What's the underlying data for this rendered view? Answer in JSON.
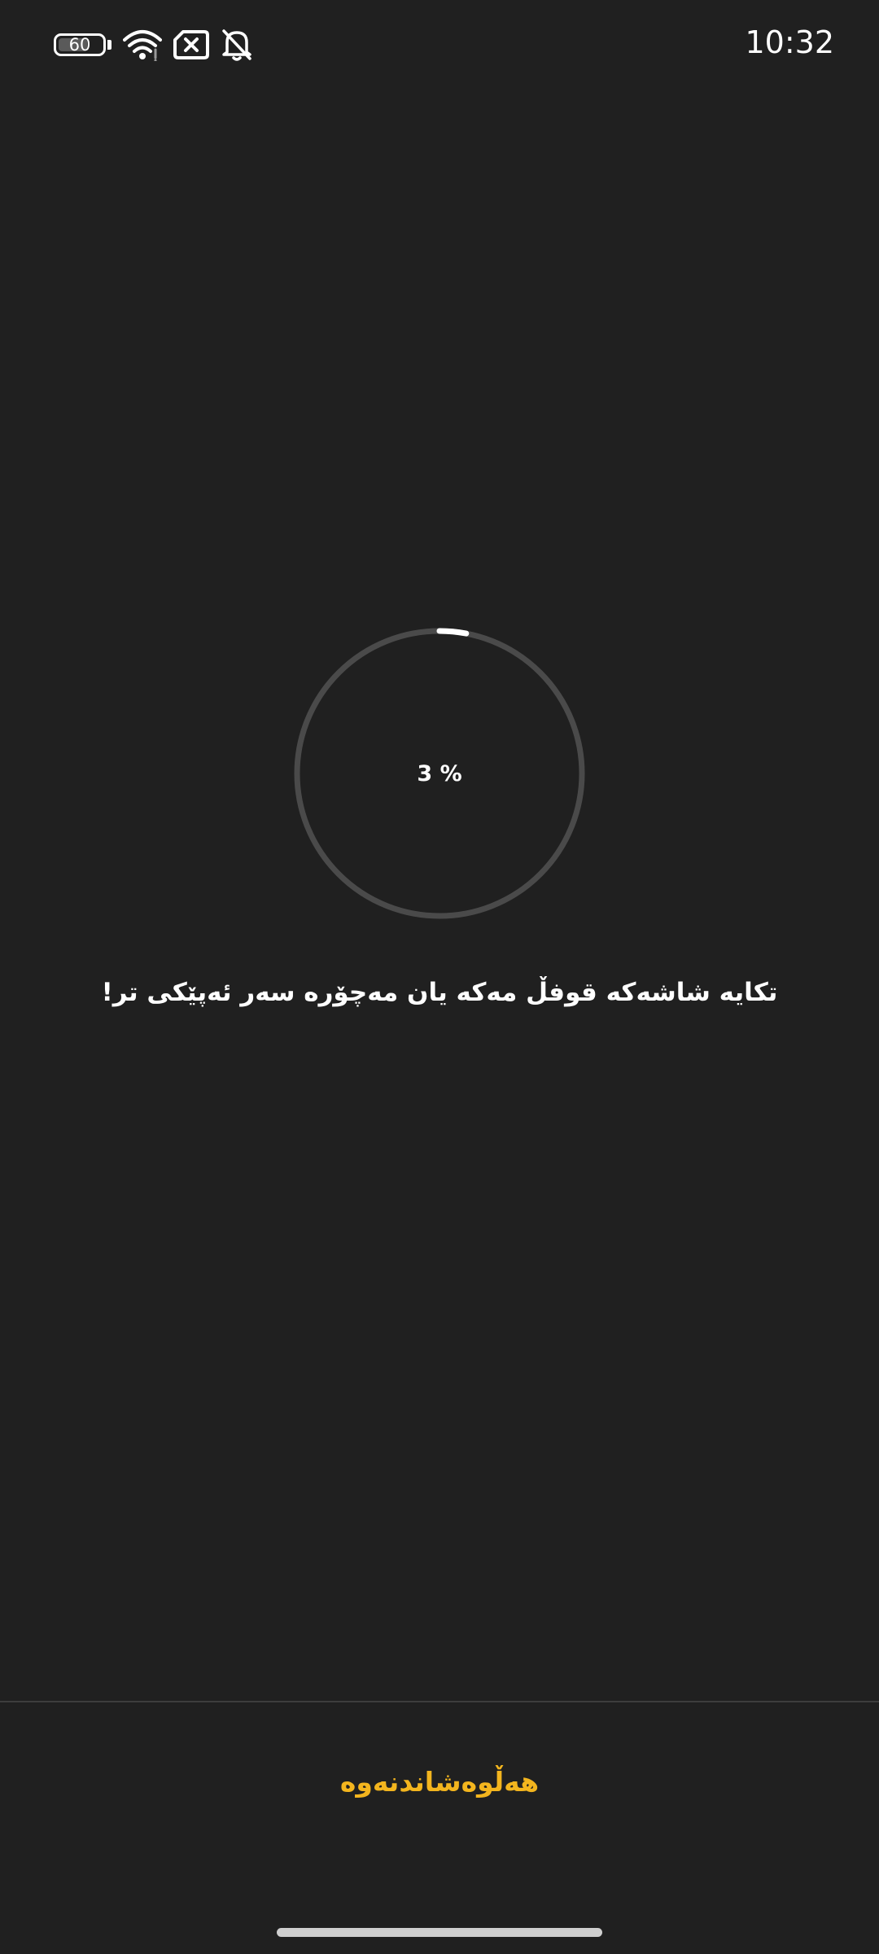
{
  "status_bar": {
    "battery_level": "60",
    "time": "10:32",
    "icons": [
      "battery-icon",
      "wifi-icon",
      "no-sim-icon",
      "notifications-off-icon"
    ]
  },
  "progress": {
    "value": 0.03,
    "label": "% 3"
  },
  "message": "تکایە شاشەکە قوفڵ مەکە یان مەچۆرە سەر ئەپێکی تر!",
  "cancel_button": {
    "label": "هەڵوەشاندنەوە"
  },
  "colors": {
    "background": "#202020",
    "accent": "#f3b51e",
    "ring_track": "#4a4a4a",
    "ring_progress": "#ffffff"
  }
}
